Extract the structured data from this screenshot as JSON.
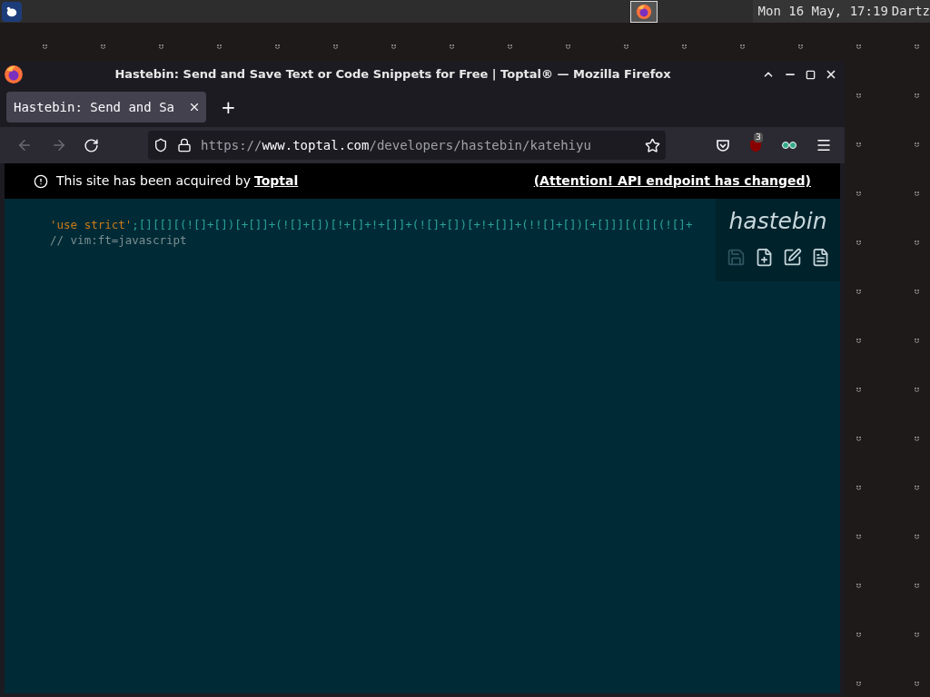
{
  "panel": {
    "clock": "Mon 16 May, 17:19",
    "user": "Dartz",
    "taskbar": [
      {
        "kind": "firefox",
        "selected": true
      }
    ]
  },
  "window": {
    "title": "Hastebin: Send and Save Text or Code Snippets for Free | Toptal® — Mozilla Firefox"
  },
  "tabs": [
    {
      "label": "Hastebin: Send and Sa",
      "selected": true
    }
  ],
  "new_tab": "+",
  "nav": {
    "back_disabled": true,
    "forward_disabled": true,
    "url_prefix": "https://",
    "domain": "www.toptal.com",
    "path": "/developers/hastebin/katehiyu",
    "extension_badge": "3"
  },
  "banner": {
    "text": "This site has been acquired by ",
    "link": "Toptal",
    "notice": "(Attention! API endpoint has changed)"
  },
  "code": [
    {
      "kind": "statement",
      "string": "'use strict'",
      "rest": ";[][[][(![]+[])[+[]]+(![]+[])[!+[]+!+[]]+(![]+[])[+!+[]]+(!![]+[])[+[]]][([][(![]+"
    },
    {
      "kind": "comment",
      "text": "// vim:ft=javascript"
    }
  ],
  "hastebin": {
    "logo": "hastebin",
    "actions": [
      {
        "kind": "save",
        "disabled": true
      },
      {
        "kind": "new",
        "disabled": false
      },
      {
        "kind": "duplicate",
        "disabled": false
      },
      {
        "kind": "raw",
        "disabled": false
      }
    ]
  }
}
